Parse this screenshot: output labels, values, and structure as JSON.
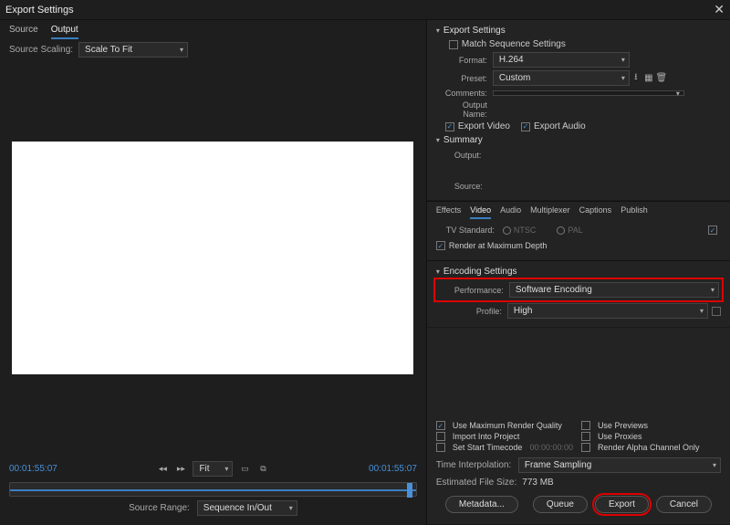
{
  "title": "Export Settings",
  "tabs": {
    "source": "Source",
    "output": "Output"
  },
  "source_scaling": {
    "label": "Source Scaling:",
    "value": "Scale To Fit"
  },
  "timecodes": {
    "left": "00:01:55:07",
    "right": "00:01:55:07"
  },
  "fit": {
    "label": "Fit",
    "value": "Fit"
  },
  "source_range": {
    "label": "Source Range:",
    "value": "Sequence In/Out"
  },
  "export_settings": {
    "title": "Export Settings",
    "match_seq": "Match Sequence Settings",
    "format_label": "Format:",
    "format_value": "H.264",
    "preset_label": "Preset:",
    "preset_value": "Custom",
    "comments_label": "Comments:",
    "output_name_label": "Output Name:",
    "export_video": "Export Video",
    "export_audio": "Export Audio",
    "summary_title": "Summary",
    "summary_output": "Output:",
    "summary_source": "Source:"
  },
  "subtabs": {
    "effects": "Effects",
    "video": "Video",
    "audio": "Audio",
    "mux": "Multiplexer",
    "captions": "Captions",
    "publish": "Publish"
  },
  "tv_standard": {
    "label": "TV Standard:",
    "ntsc": "NTSC",
    "pal": "PAL"
  },
  "render_max_depth": "Render at Maximum Depth",
  "encoding": {
    "title": "Encoding Settings",
    "perf_label": "Performance:",
    "perf_value": "Software Encoding",
    "profile_label": "Profile:",
    "profile_value": "High"
  },
  "opts": {
    "max_quality": "Use Maximum Render Quality",
    "use_previews": "Use Previews",
    "import_project": "Import Into Project",
    "use_proxies": "Use Proxies",
    "set_start_tc": "Set Start Timecode",
    "set_start_tc_val": "00:00:00:00",
    "render_alpha": "Render Alpha Channel Only",
    "time_interp_label": "Time Interpolation:",
    "time_interp_value": "Frame Sampling",
    "est_size_label": "Estimated File Size:",
    "est_size_value": "773 MB"
  },
  "buttons": {
    "metadata": "Metadata...",
    "queue": "Queue",
    "export": "Export",
    "cancel": "Cancel"
  }
}
